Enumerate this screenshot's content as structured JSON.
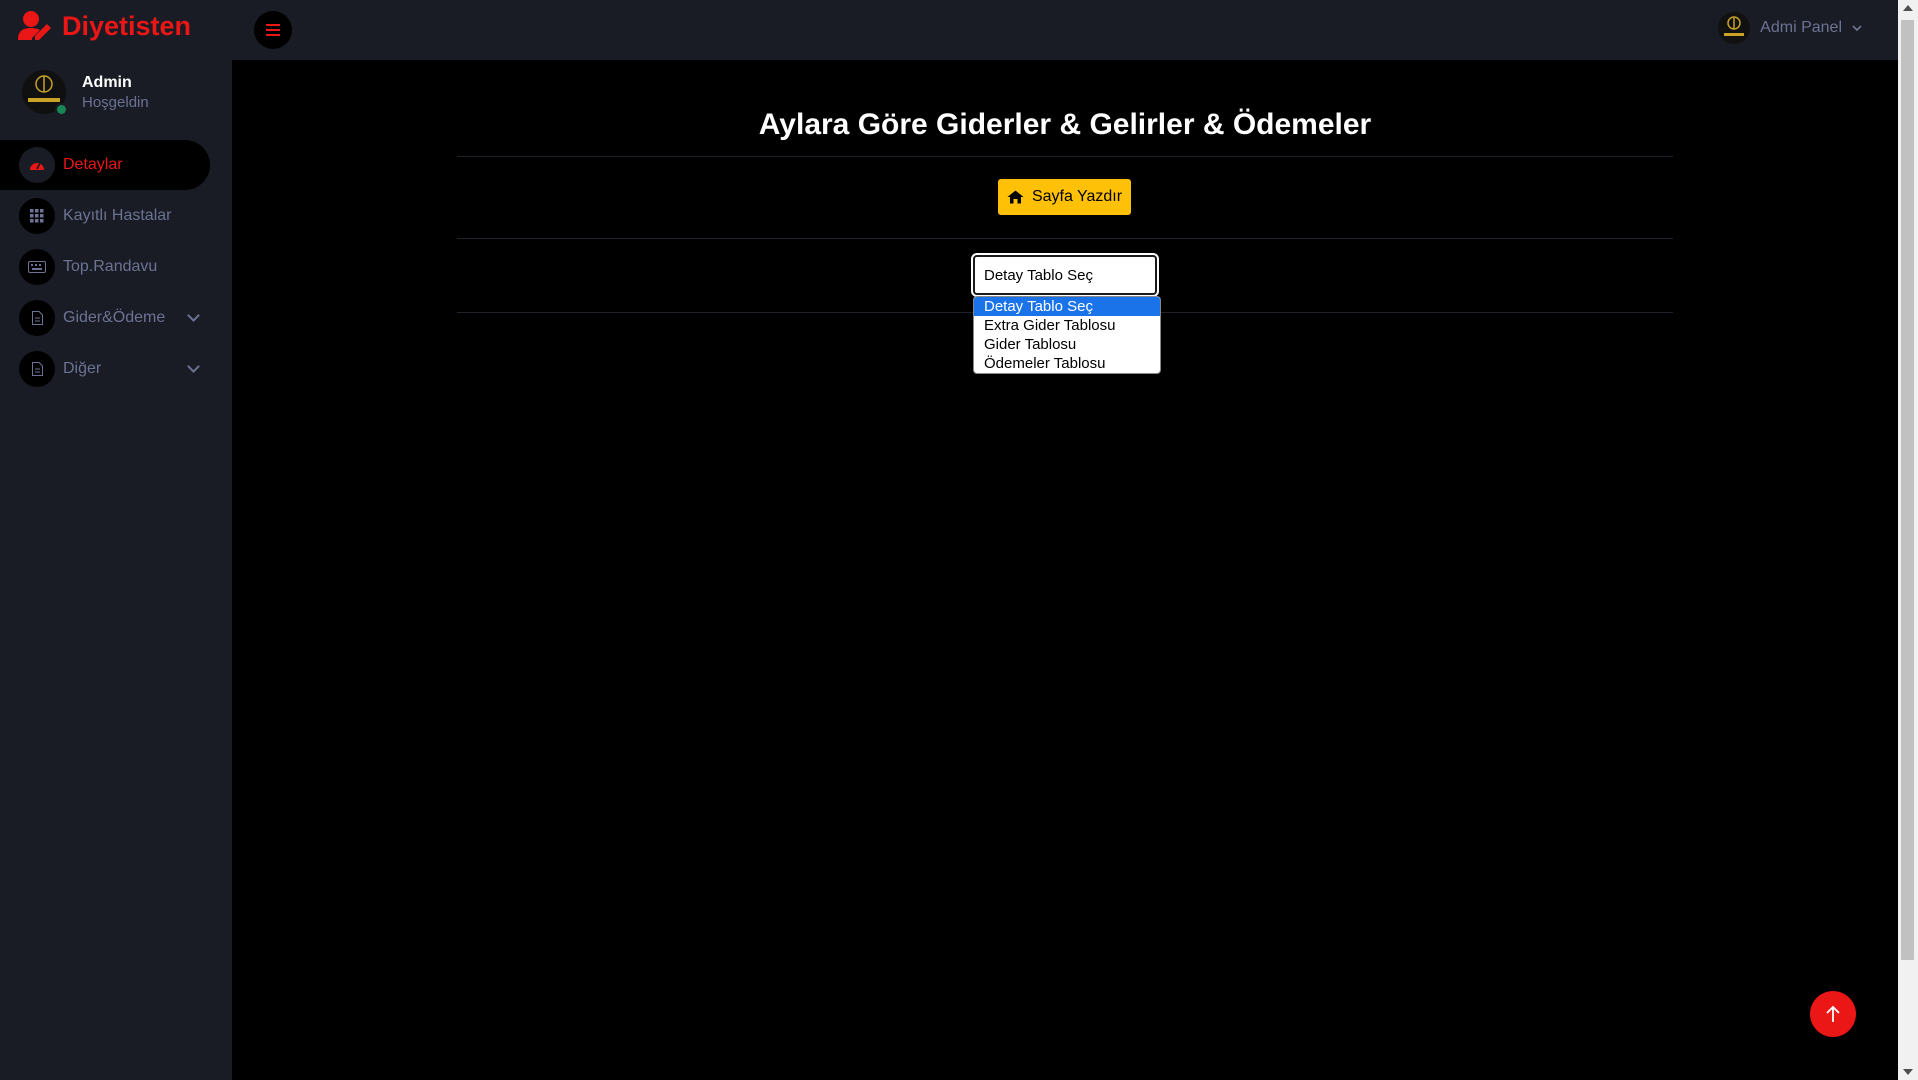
{
  "brand": {
    "name": "Diyetisten",
    "icon": "user-edit-icon",
    "color": "#eb1616"
  },
  "header": {
    "admin_label": "Admi Panel"
  },
  "profile": {
    "name": "Admin",
    "greeting": "Hoşgeldin",
    "status_color": "#198754"
  },
  "sidebar": {
    "items": [
      {
        "label": "Detaylar",
        "icon": "tachometer-icon",
        "active": true
      },
      {
        "label": "Kayıtlı Hastalar",
        "icon": "grid-icon"
      },
      {
        "label": "Top.Randavu",
        "icon": "keyboard-icon"
      },
      {
        "label": "Gider&Ödeme",
        "icon": "file-icon",
        "expandable": true
      },
      {
        "label": "Diğer",
        "icon": "file-icon",
        "expandable": true
      }
    ]
  },
  "main": {
    "title": "Aylara Göre Giderler & Gelirler & Ödemeler",
    "print_button": "Sayfa Yazdır",
    "select": {
      "value": "Detay Tablo Seç",
      "options": [
        "Detay Tablo Seç",
        "Extra Gider Tablosu",
        "Gider Tablosu",
        "Ödemeler Tablosu"
      ]
    }
  },
  "colors": {
    "accent": "#eb1616",
    "sidebar_bg": "#191c24",
    "button_warning": "#ffc107"
  }
}
